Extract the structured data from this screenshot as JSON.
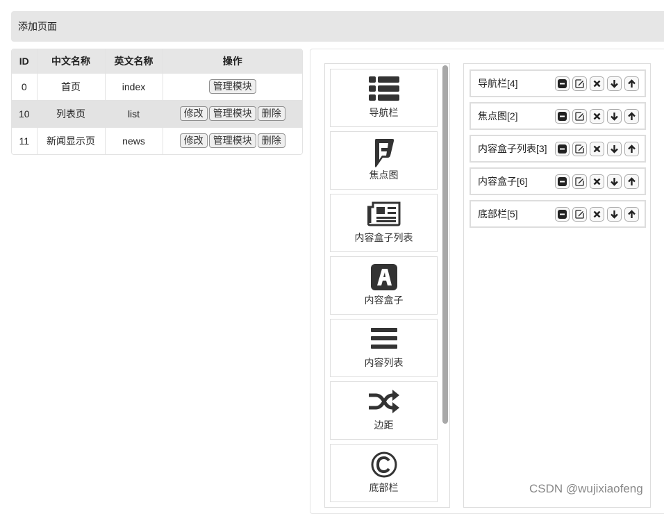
{
  "topbar": {
    "title": "添加页面"
  },
  "table": {
    "headers": [
      "ID",
      "中文名称",
      "英文名称",
      "操作"
    ],
    "rows": [
      {
        "id": "0",
        "cn": "首页",
        "en": "index",
        "actions": [
          "管理模块"
        ]
      },
      {
        "id": "10",
        "cn": "列表页",
        "en": "list",
        "actions": [
          "修改",
          "管理模块",
          "删除"
        ]
      },
      {
        "id": "11",
        "cn": "新闻显示页",
        "en": "news",
        "actions": [
          "修改",
          "管理模块",
          "删除"
        ]
      }
    ]
  },
  "palette": {
    "items": [
      {
        "label": "导航栏",
        "icon": "list-icon"
      },
      {
        "label": "焦点图",
        "icon": "foursquare-icon"
      },
      {
        "label": "内容盒子列表",
        "icon": "newspaper-icon"
      },
      {
        "label": "内容盒子",
        "icon": "font-awesome-a-icon"
      },
      {
        "label": "内容列表",
        "icon": "bars-icon"
      },
      {
        "label": "边距",
        "icon": "shuffle-icon"
      },
      {
        "label": "底部栏",
        "icon": "copyright-icon"
      }
    ]
  },
  "modules": {
    "items": [
      {
        "name": "导航栏[4]"
      },
      {
        "name": "焦点图[2]"
      },
      {
        "name": "内容盒子列表[3]"
      },
      {
        "name": "内容盒子[6]"
      },
      {
        "name": "底部栏[5]"
      }
    ],
    "control_icons": [
      "minus-square-icon",
      "edit-icon",
      "close-icon",
      "arrow-down-icon",
      "arrow-up-icon"
    ]
  },
  "watermark": {
    "text": "CSDN @wujixiaofeng"
  }
}
